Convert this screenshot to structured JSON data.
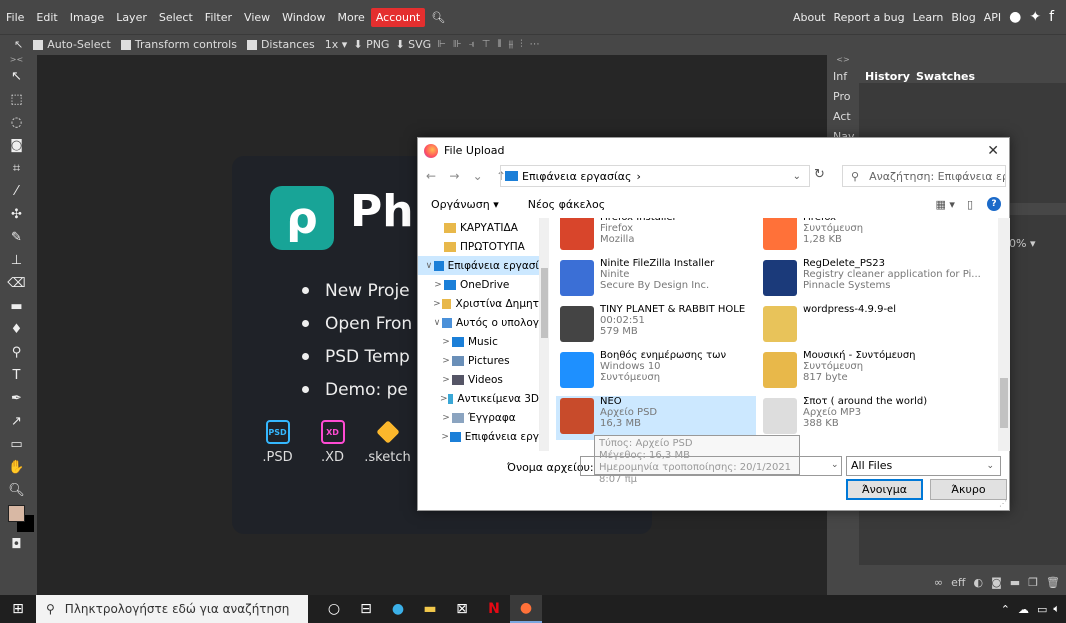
{
  "menubar": {
    "items": [
      "File",
      "Edit",
      "Image",
      "Layer",
      "Select",
      "Filter",
      "View",
      "Window",
      "More",
      "Account"
    ],
    "right": [
      "About",
      "Report a bug",
      "Learn",
      "Blog",
      "API"
    ]
  },
  "options": {
    "auto_select": "Auto-Select",
    "transform": "Transform controls",
    "distances": "Distances",
    "zoom": "1x",
    "png": "PNG",
    "svg": "SVG"
  },
  "welcome": {
    "logo_text": "Ph",
    "items": [
      "New Proje",
      "Open Fron",
      "PSD Temp",
      "Demo:  pe"
    ],
    "formats": [
      {
        "label": ".PSD",
        "icon": "PSD",
        "color": "#35b8ff"
      },
      {
        "label": ".XD",
        "icon": "XD",
        "color": "#ff4bd3"
      },
      {
        "label": ".sketch",
        "icon": "",
        "color": "#fbb72c"
      }
    ]
  },
  "panels": {
    "mini": [
      "Inf",
      "Pro",
      "Act",
      "Nav"
    ],
    "tabs": [
      "History",
      "Swatches"
    ],
    "zoom_pct": "0%"
  },
  "dialog": {
    "title": "File Upload",
    "address": "Επιφάνεια εργασίας",
    "search_placeholder": "Αναζήτηση: Επιφάνεια εργα...",
    "organize": "Οργάνωση ▾",
    "new_folder": "Νέος φάκελος",
    "nav": [
      {
        "label": "ΚΑΡΥΑΤΙΔΑ",
        "chev": "",
        "color": "#e8b84a",
        "indent": 1
      },
      {
        "label": "ΠΡΩΤΟΤΥΠΑ",
        "chev": "",
        "color": "#e8b84a",
        "indent": 1
      },
      {
        "label": "Επιφάνεια εργασί",
        "chev": "∨",
        "color": "#1b7fd8",
        "indent": 0,
        "sel": true
      },
      {
        "label": "OneDrive",
        "chev": ">",
        "color": "#1b7fd8",
        "indent": 1
      },
      {
        "label": "Χριστίνα Δημητ",
        "chev": ">",
        "color": "#e8b84a",
        "indent": 1
      },
      {
        "label": "Αυτός ο υπολογ",
        "chev": "∨",
        "color": "#4a90d9",
        "indent": 1
      },
      {
        "label": "Music",
        "chev": ">",
        "color": "#1b7fd8",
        "indent": 2
      },
      {
        "label": "Pictures",
        "chev": ">",
        "color": "#6a8fb8",
        "indent": 2
      },
      {
        "label": "Videos",
        "chev": ">",
        "color": "#556",
        "indent": 2
      },
      {
        "label": "Αντικείμενα 3D",
        "chev": ">",
        "color": "#39a7d6",
        "indent": 2
      },
      {
        "label": "Έγγραφα",
        "chev": ">",
        "color": "#8ba4c0",
        "indent": 2
      },
      {
        "label": "Επιφάνεια εργ",
        "chev": ">",
        "color": "#1b7fd8",
        "indent": 2
      }
    ],
    "files": [
      {
        "name": "Firefox Installer",
        "l2": "Firefox",
        "l3": "Mozilla",
        "color": "#d8452b"
      },
      {
        "name": "Firefox",
        "l2": "Συντόμευση",
        "l3": "1,28 KB",
        "color": "#ff7139"
      },
      {
        "name": "Ninite FileZilla Installer",
        "l2": "Ninite",
        "l3": "Secure By Design Inc.",
        "color": "#3b6fd6"
      },
      {
        "name": "RegDelete_PS23",
        "l2": "Registry cleaner application for Pi...",
        "l3": "Pinnacle Systems",
        "color": "#1b3a7a"
      },
      {
        "name": "TINY PLANET & RABBIT HOLE",
        "l2": "00:02:51",
        "l3": "579 MB",
        "color": "#444"
      },
      {
        "name": "wordpress-4.9.9-el",
        "l2": "",
        "l3": "",
        "color": "#e8c35a"
      },
      {
        "name": "Βοηθός ενημέρωσης των",
        "l2": "Windows 10",
        "l3": "Συντόμευση",
        "color": "#1e90ff"
      },
      {
        "name": "Μουσική - Συντόμευση",
        "l2": "Συντόμευση",
        "l3": "817 byte",
        "color": "#e8b84a"
      },
      {
        "name": "NEO",
        "l2": "Αρχείο PSD",
        "l3": "16,3 MB",
        "color": "#c84b2b"
      },
      {
        "name": "Σποτ ( around the world)",
        "l2": "Αρχείο MP3",
        "l3": "388 KB",
        "color": "#ddd"
      }
    ],
    "tooltip": [
      "Τύπος: Αρχείο PSD",
      "Μέγεθος: 16,3 MB",
      "Ημερομηνία τροποποίησης: 20/1/2021 8:07 πμ"
    ],
    "filename_label": "Όνομα αρχείου:",
    "filter": "All Files",
    "open": "Άνοιγμα",
    "cancel": "Άκυρο"
  },
  "taskbar": {
    "search": "Πληκτρολογήστε εδώ για αναζήτηση"
  }
}
